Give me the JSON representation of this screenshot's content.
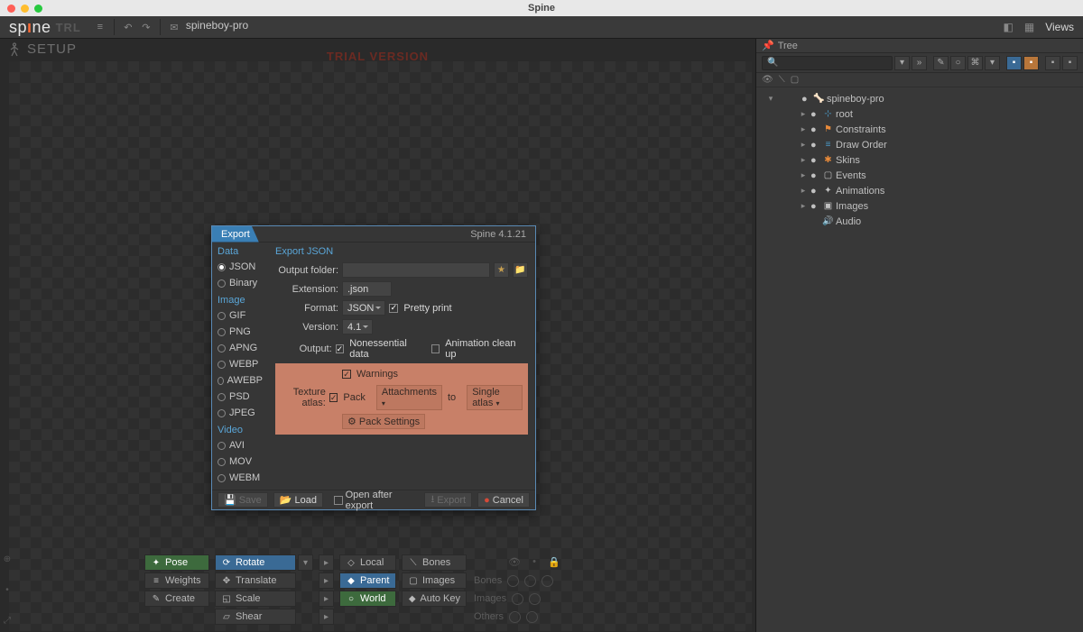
{
  "mac_title": "Spine",
  "toolbar": {
    "brand_letters": [
      "s",
      "p",
      "ı",
      "n",
      "e"
    ],
    "trial_badge": "TRL",
    "project": "spineboy-pro",
    "views": "Views"
  },
  "stage": {
    "mode": "SETUP",
    "watermark": "TRIAL VERSION"
  },
  "bottom_tools": {
    "col1": [
      "Pose",
      "Weights",
      "Create"
    ],
    "col1_active": 0,
    "col2": [
      "Rotate",
      "Translate",
      "Scale",
      "Shear"
    ],
    "col2_active": 0,
    "col3": [
      "Local",
      "Parent",
      "World"
    ],
    "col3_active": 1,
    "col4": [
      "Bones",
      "Images",
      "Auto Key"
    ],
    "list_hdr": [
      "👁",
      "•",
      "🔒"
    ],
    "list": [
      "Bones",
      "Images",
      "Others"
    ]
  },
  "tree": {
    "title": "Tree",
    "root": "spineboy-pro",
    "nodes": [
      {
        "label": "root",
        "cls": "blue-i",
        "icon": "⊹"
      },
      {
        "label": "Constraints",
        "cls": "orange",
        "icon": "⚑"
      },
      {
        "label": "Draw Order",
        "cls": "blue-i",
        "icon": "≡"
      },
      {
        "label": "Skins",
        "cls": "orange",
        "icon": "✱"
      },
      {
        "label": "Events",
        "cls": "",
        "icon": "▢"
      },
      {
        "label": "Animations",
        "cls": "",
        "icon": "✦"
      },
      {
        "label": "Images",
        "cls": "",
        "icon": "▣"
      },
      {
        "label": "Audio",
        "cls": "",
        "icon": "🔊"
      }
    ]
  },
  "export": {
    "title": "Export",
    "version": "Spine 4.1.21",
    "side": {
      "data_hdr": "Data",
      "data": [
        "JSON",
        "Binary"
      ],
      "data_sel": 0,
      "image_hdr": "Image",
      "image": [
        "GIF",
        "PNG",
        "APNG",
        "WEBP",
        "AWEBP",
        "PSD",
        "JPEG"
      ],
      "video_hdr": "Video",
      "video": [
        "AVI",
        "MOV",
        "WEBM"
      ]
    },
    "main": {
      "title": "Export JSON",
      "output_folder_lbl": "Output folder:",
      "output_folder": "",
      "extension_lbl": "Extension:",
      "extension": ".json",
      "format_lbl": "Format:",
      "format_sel": "JSON",
      "pretty": "Pretty print",
      "version_lbl": "Version:",
      "version_sel": "4.1",
      "output_lbl": "Output:",
      "nonessential": "Nonessential data",
      "anim_cleanup": "Animation clean up",
      "warnings": "Warnings",
      "tex_lbl": "Texture atlas:",
      "pack": "Pack",
      "attachments": "Attachments",
      "to": "to",
      "single": "Single atlas",
      "pack_settings": "Pack Settings"
    },
    "footer": {
      "save": "Save",
      "load": "Load",
      "open_after": "Open after export",
      "export": "Export",
      "cancel": "Cancel"
    }
  }
}
